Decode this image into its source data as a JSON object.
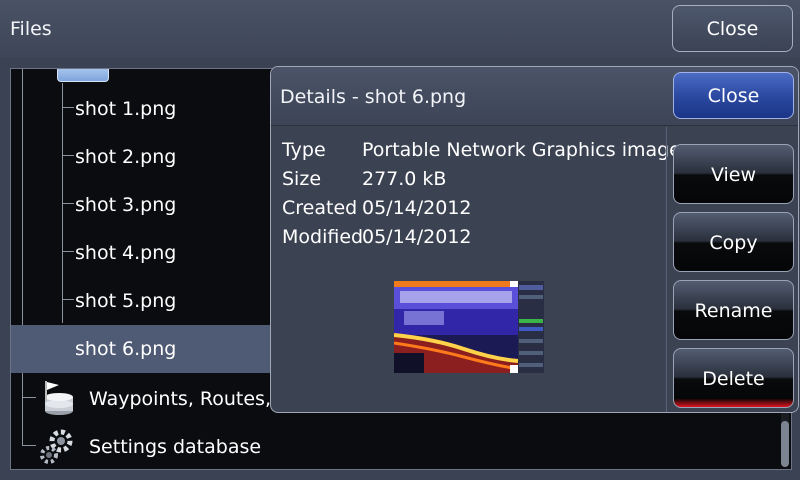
{
  "header": {
    "title": "Files",
    "close_label": "Close"
  },
  "tree": {
    "items": [
      {
        "label": "shot 1.png"
      },
      {
        "label": "shot 2.png"
      },
      {
        "label": "shot 3.png"
      },
      {
        "label": "shot 4.png"
      },
      {
        "label": "shot 5.png"
      },
      {
        "label": "shot 6.png"
      }
    ],
    "waypoints_label": "Waypoints, Routes, a",
    "settings_label": "Settings database",
    "selected": "shot 6.png"
  },
  "dialog": {
    "title": "Details - shot 6.png",
    "close_label": "Close",
    "info": [
      {
        "key": "Type",
        "value": "Portable Network Graphics image"
      },
      {
        "key": "Size",
        "value": "277.0 kB"
      },
      {
        "key": "Created",
        "value": "05/14/2012"
      },
      {
        "key": "Modified",
        "value": "05/14/2012"
      }
    ],
    "buttons": {
      "view": "View",
      "copy": "Copy",
      "rename": "Rename",
      "delete": "Delete"
    }
  },
  "colors": {
    "selected_row": "#4f5a74",
    "dialog_close_accent": "#2c4aa2",
    "delete_accent": "#e01420"
  },
  "icons": {
    "folder": "folder-icon",
    "waypoints": "database-flag-icon",
    "settings": "gears-icon"
  }
}
